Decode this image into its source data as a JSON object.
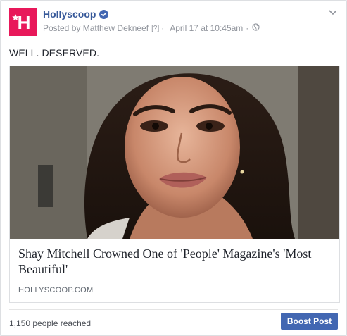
{
  "page": {
    "name": "Hollyscoop",
    "verified": true,
    "avatar_letter": "H"
  },
  "meta": {
    "prefix": "Posted by",
    "author": "Matthew Dekneef",
    "help_marker": "[?]",
    "separator": "·",
    "timestamp": "April 17 at 10:45am",
    "privacy_icon": "globe-icon"
  },
  "post": {
    "caption": "WELL. DESERVED."
  },
  "link": {
    "title": "Shay Mitchell Crowned One of 'People' Magazine's 'Most Beautiful'",
    "domain": "HOLLYSCOOP.COM"
  },
  "footer": {
    "reach": "1,150 people reached",
    "boost_label": "Boost Post"
  },
  "colors": {
    "brand_pink": "#e8185a",
    "link_blue": "#365899",
    "button_blue": "#4267b2"
  }
}
